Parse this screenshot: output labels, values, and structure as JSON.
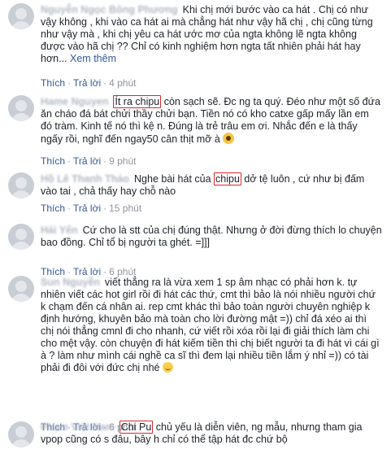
{
  "actions": {
    "like": "Thích",
    "reply": "Trả lời",
    "separator": "·"
  },
  "comments": [
    {
      "author": "Nguyễn Ngọc Bông Phương",
      "text": "Khi chị mới bước vào ca hát . Chị có như vậy không , khi vào ca hát ai mà chẳng hát như vậy hã chị , chị cũng từng như vậy mà , khi chị yêu ca hát ước mơ của ngta không lẽ ngta không được vào hã chị ?? Chỉ có kinh nghiệm hơn ngta tất nhiên phải hát hay hơn...",
      "see_more": "Xem thêm",
      "time": "4 phút"
    },
    {
      "author": "Hame Nguyen",
      "highlight": "Ít ra chipu",
      "text_after": " còn sạch sẽ. Đc ng ta quý. Đéo như một số đứa ăn cháo đá bát chửi thầy chửi bạn. Tiền nó có kho catxe gấp mấy lần em đó tràm. Kinh tế nó thì kệ n. Đúng là trẻ trâu em ơi. Nhắc đến e là thấy ngấy rồi, nghĩ đến ngay50 cân thịt mỡ à",
      "time": "9 phút"
    },
    {
      "author": "Hồ Lê Thanh Thảo",
      "text_before": "Nghe bài hát của ",
      "highlight": "chipu",
      "text_after": " dở tệ luôn , cứ như bị đấm vào tai , chả thấy hay chỗ nào",
      "time": "15 phút"
    },
    {
      "author": "Hải Yến",
      "text": "Cứ cho là stt của chị đúng thật. Nhưng ở đời đừng thích lo chuyện bao đồng. Chỉ tổ bị người ta ghét. =]]]",
      "time": "6 phút"
    },
    {
      "author": "Sun Nguyễn",
      "text": "viết thẳng ra là vừa xem 1 sp âm nhạc có phải hơn k. tự nhiên viết các hot girl rồi đi hát các thứ, cmt thì bảo là nói nhiều người chứ k chạm đến cá nhân ai. rep cmt khác thì bảo toàn người chuyên nghiệp k định hướng, khuyên bảo mà toàn cho lời đường mật =)) chỉ đá xéo ai thì chị nói thẳng cmnl đi cho nhanh, cứ viết rồi xóa rồi lại đi giải thích làm chi cho mệt vậy. còn chuyện đi hát kiếm tiền thì chị biết người ta đi hát vì cái gì à ? làm như mình cái nghề ca sĩ thì đem lại nhiều tiền lắm ý nhỉ =)) có tài phải đi đôi với đức chị nhé",
      "time": "6 phút"
    },
    {
      "author": "Phạm Việt Nam",
      "highlight": "Chi Pu",
      "text_after": " chủ yếu là diễn viên, ng mẫu, nhưng tham gia vpop cũng có s đâu, bây h chỉ có thể tập hát đc chứ bộ"
    }
  ],
  "colors": {
    "link": "#365899",
    "highlight_border": "#d9272e",
    "meta": "#90949c"
  }
}
